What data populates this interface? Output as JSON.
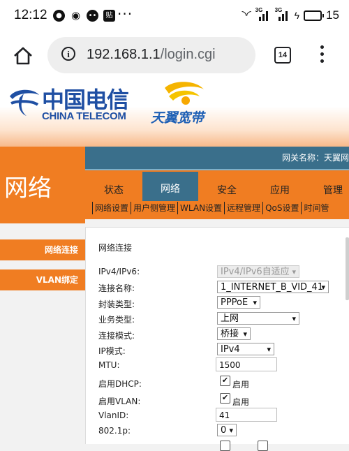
{
  "status_bar": {
    "time": "12:12",
    "notification_icons": [
      "chat-icon",
      "weibo-icon",
      "message-icon",
      "tieba-icon"
    ],
    "overflow": "···",
    "signal_labels": [
      "3G",
      "3G"
    ],
    "battery_level": "15"
  },
  "browser": {
    "url_host": "192.168.1.1",
    "url_path": "/login.cgi",
    "tab_count": "14"
  },
  "banner": {
    "brand_cn": "中国电信",
    "brand_en": "CHINA TELECOM",
    "product_cn": "天翼宽带"
  },
  "nav": {
    "section_title": "网络",
    "gateway_label": "网关名称：天翼网",
    "tabs": [
      {
        "label": "状态",
        "active": false
      },
      {
        "label": "网络",
        "active": true
      },
      {
        "label": "安全",
        "active": false
      },
      {
        "label": "应用",
        "active": false
      },
      {
        "label": "管理",
        "active": false
      }
    ],
    "sub_items": [
      "网络设置",
      "用户侧管理",
      "WLAN设置",
      "远程管理",
      "QoS设置",
      "时间管"
    ]
  },
  "sidebar": {
    "items": [
      {
        "label": "网络连接"
      },
      {
        "label": "VLAN绑定"
      }
    ]
  },
  "form": {
    "title": "网络连接",
    "fields": [
      {
        "label": "IPv4/IPv6:",
        "value": "IPv4/IPv6自适应",
        "type": "select",
        "disabled": true
      },
      {
        "label": "连接名称:",
        "value": "1_INTERNET_B_VID_41",
        "type": "select"
      },
      {
        "label": "封装类型:",
        "value": "PPPoE",
        "type": "select"
      },
      {
        "label": "业务类型:",
        "value": "上网",
        "type": "select"
      },
      {
        "label": "连接模式:",
        "value": "桥接",
        "type": "select"
      },
      {
        "label": "IP模式:",
        "value": "IPv4",
        "type": "select"
      },
      {
        "label": "MTU:",
        "value": "1500",
        "type": "input"
      },
      {
        "label": "启用DHCP:",
        "value": "启用",
        "type": "checkbox",
        "checked": true
      },
      {
        "label": "启用VLAN:",
        "value": "启用",
        "type": "checkbox",
        "checked": true
      },
      {
        "label": "VlanID:",
        "value": "41",
        "type": "input"
      },
      {
        "label": "802.1p:",
        "value": "0",
        "type": "select"
      }
    ]
  },
  "colors": {
    "orange": "#f07d22",
    "steel_blue": "#3a6f8b",
    "brand_blue": "#1f4fa3"
  }
}
